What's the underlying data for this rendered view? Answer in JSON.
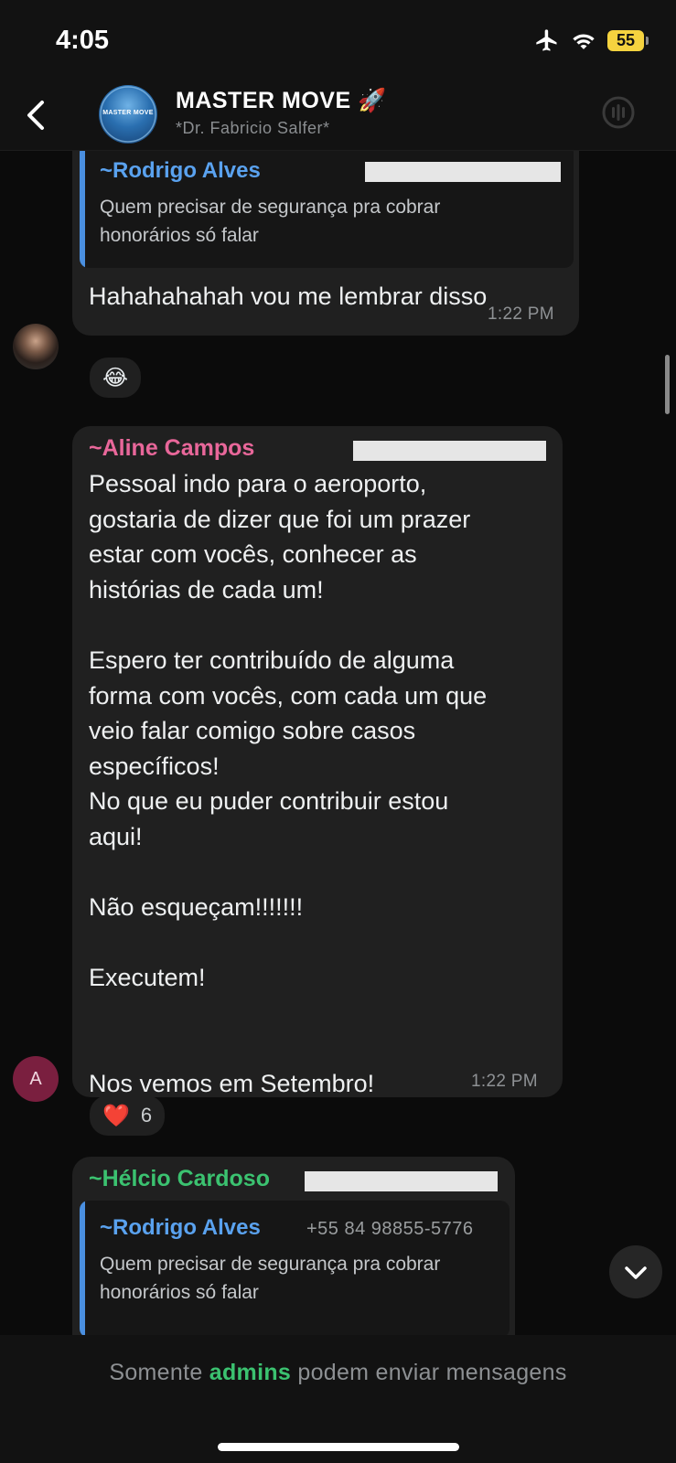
{
  "status": {
    "time": "4:05",
    "battery": "55"
  },
  "header": {
    "title": "MASTER MOVE 🚀",
    "subtitle": "*Dr. Fabricio Salfer*",
    "avatar_text": "MASTER MOVE"
  },
  "messages": [
    {
      "quote": {
        "name": "~Rodrigo Alves",
        "text": "Quem precisar de segurança pra cobrar honorários só falar"
      },
      "text": "Hahahahahah vou me lembrar disso",
      "time": "1:22 PM",
      "reaction": {
        "emoji": "😂"
      }
    },
    {
      "sender": "~Aline Campos",
      "sender_color": "#e8679a",
      "text": "Pessoal indo para o aeroporto,\ngostaria de dizer que foi um prazer\nestar com vocês, conhecer as\nhistórias de cada um!\n\nEspero ter contribuído de alguma\nforma com vocês, com cada um que\nveio falar comigo sobre casos\nespecíficos!\nNo que eu puder contribuir estou\naqui!\n\nNão esqueçam!!!!!!!\n\nExecutem!\n\n\nNos vemos em Setembro!",
      "time": "1:22 PM",
      "avatar_letter": "A",
      "reaction": {
        "emoji": "❤️",
        "count": "6"
      }
    },
    {
      "sender": "~Hélcio Cardoso",
      "sender_color": "#3bc270",
      "quote": {
        "name": "~Rodrigo Alves",
        "phone": "+55 84 98855-5776",
        "text": "Quem precisar de segurança pra cobrar honorários só falar"
      }
    }
  ],
  "footer": {
    "prefix": "Somente",
    "admins": "admins",
    "suffix": "podem enviar mensagens"
  },
  "colors": {
    "accent_green": "#3bc270",
    "quote_blue": "#5aa2ef",
    "bubble": "#202020"
  }
}
